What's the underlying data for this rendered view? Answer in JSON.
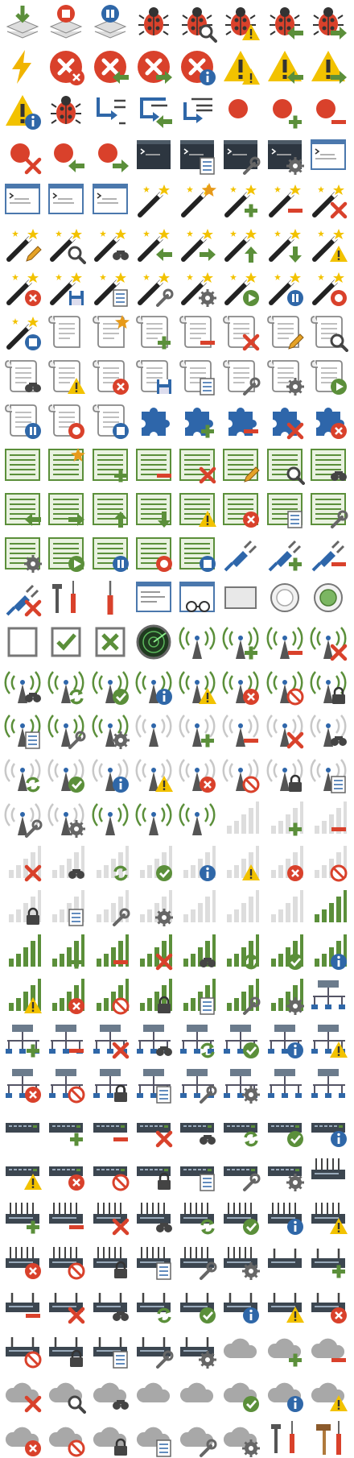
{
  "sheet": {
    "columns": 8,
    "rows": 32,
    "icons": [
      "download-stack-icon",
      "stop-stack-icon",
      "pause-stack-icon",
      "bug-icon",
      "bug-search-icon",
      "bug-warning-icon",
      "bug-back-icon",
      "bug-forward-icon",
      "lightning-icon",
      "error-icon",
      "error-back-icon",
      "error-forward-icon",
      "error-info-icon",
      "warning-icon",
      "warning-back-icon",
      "warning-forward-icon",
      "warning-info-icon",
      "bug-inspect-icon",
      "step-into-icon",
      "step-back-icon",
      "step-over-icon",
      "breakpoint-icon",
      "breakpoint-add-icon",
      "breakpoint-remove-icon",
      "breakpoint-delete-icon",
      "breakpoint-back-icon",
      "breakpoint-forward-icon",
      "console-icon",
      "console-checklist-icon",
      "console-wrench-icon",
      "console-gear-icon",
      "console-window-icon",
      "console-checklist-window-icon",
      "console-wrench-window-icon",
      "console-gear-window-icon",
      "wand-icon",
      "wand-star-icon",
      "wand-add-icon",
      "wand-remove-icon",
      "wand-delete-icon",
      "wand-edit-icon",
      "wand-search-icon",
      "wand-find-icon",
      "wand-back-icon",
      "wand-forward-icon",
      "wand-up-icon",
      "wand-down-icon",
      "wand-warning-icon",
      "wand-error-icon",
      "wand-save-icon",
      "wand-checklist-icon",
      "wand-wrench-icon",
      "wand-gear-icon",
      "wand-play-icon",
      "wand-pause-icon",
      "wand-record-icon",
      "wand-stop-icon",
      "script-icon",
      "script-star-icon",
      "script-add-icon",
      "script-remove-icon",
      "script-delete-icon",
      "script-edit-icon",
      "script-search-icon",
      "script-find-icon",
      "script-warning-icon",
      "script-error-icon",
      "script-save-icon",
      "script-checklist-icon",
      "script-wrench-icon",
      "script-gear-icon",
      "script-play-icon",
      "script-pause-icon",
      "script-record-icon",
      "script-stop-icon",
      "plugin-icon",
      "plugin-add-icon",
      "plugin-remove-icon",
      "plugin-delete-icon",
      "plugin-error-icon",
      "list-icon",
      "list-star-icon",
      "list-add-icon",
      "list-remove-icon",
      "list-delete-icon",
      "list-edit-icon",
      "list-search-icon",
      "list-find-icon",
      "list-back-icon",
      "list-forward-icon",
      "list-up-icon",
      "list-down-icon",
      "list-warning-icon",
      "list-error-icon",
      "list-checklist-icon",
      "list-wrench-icon",
      "list-gear-icon",
      "list-play-icon",
      "list-pause-icon",
      "list-record-icon",
      "list-stop-icon",
      "plug-icon",
      "plug-add-icon",
      "plug-remove-icon",
      "plug-delete-icon",
      "tools-icon",
      "screwdriver-icon",
      "window-form-icon",
      "window-glasses-icon",
      "rectangle-icon",
      "circle-icon",
      "circle-selected-icon",
      "checkbox-empty-icon",
      "checkbox-checked-icon",
      "checkbox-crossed-icon",
      "radar-icon",
      "antenna-icon",
      "antenna-add-icon",
      "antenna-remove-icon",
      "antenna-delete-icon",
      "antenna-find-icon",
      "antenna-sync-icon",
      "antenna-ok-icon",
      "antenna-info-icon",
      "antenna-warning-icon",
      "antenna-error-icon",
      "antenna-blocked-icon",
      "antenna-locked-icon",
      "antenna-checklist-icon",
      "antenna-wrench-icon",
      "antenna-gear-icon",
      "antenna-off-icon",
      "antenna-off-add-icon",
      "antenna-off-remove-icon",
      "antenna-off-delete-icon",
      "antenna-off-find-icon",
      "antenna-off-sync-icon",
      "antenna-off-ok-icon",
      "antenna-off-info-icon",
      "antenna-off-warning-icon",
      "antenna-off-error-icon",
      "antenna-off-blocked-icon",
      "antenna-off-locked-icon",
      "antenna-off-checklist-icon",
      "antenna-off-wrench-icon",
      "antenna-off-gear-icon",
      "antenna-green-icon",
      "antenna-green-alt-icon",
      "antenna-green-full-icon",
      "signal-empty-icon",
      "signal-add-icon",
      "signal-remove-icon",
      "signal-delete-icon",
      "signal-find-icon",
      "signal-sync-icon",
      "signal-ok-icon",
      "signal-info-icon",
      "signal-warning-icon",
      "signal-error-icon",
      "signal-blocked-icon",
      "signal-locked-icon",
      "signal-checklist-icon",
      "signal-wrench-icon",
      "signal-gear-icon",
      "signal-low-icon",
      "signal-medium-icon",
      "signal-high-icon",
      "signal-full-icon",
      "signal-full-alt-icon",
      "signal-full-add-icon",
      "signal-full-remove-icon",
      "signal-full-delete-icon",
      "signal-full-find-icon",
      "signal-full-sync-icon",
      "signal-full-ok-icon",
      "signal-full-info-icon",
      "signal-full-warning-icon",
      "signal-full-error-icon",
      "signal-full-blocked-icon",
      "signal-full-locked-icon",
      "signal-full-checklist-icon",
      "signal-full-wrench-icon",
      "signal-full-gear-icon",
      "network-icon",
      "network-add-icon",
      "network-remove-icon",
      "network-delete-icon",
      "network-find-icon",
      "network-sync-icon",
      "network-ok-icon",
      "network-info-icon",
      "network-warning-icon",
      "network-error-icon",
      "network-blocked-icon",
      "network-locked-icon",
      "network-checklist-icon",
      "network-wrench-icon",
      "network-gear-icon",
      "network-ok-alt-icon",
      "network-error-alt-icon",
      "switch-icon",
      "switch-add-icon",
      "switch-remove-icon",
      "switch-delete-icon",
      "switch-find-icon",
      "switch-sync-icon",
      "switch-ok-icon",
      "switch-info-icon",
      "switch-warning-icon",
      "switch-error-icon",
      "switch-blocked-icon",
      "switch-locked-icon",
      "switch-checklist-icon",
      "switch-wrench-icon",
      "switch-gear-icon",
      "hub-icon",
      "hub-add-icon",
      "hub-remove-icon",
      "hub-delete-icon",
      "hub-find-icon",
      "hub-sync-icon",
      "hub-ok-icon",
      "hub-info-icon",
      "hub-warning-icon",
      "hub-error-icon",
      "hub-blocked-icon",
      "hub-locked-icon",
      "hub-checklist-icon",
      "hub-wrench-icon",
      "hub-gear-icon",
      "router-icon",
      "router-add-icon",
      "router-remove-icon",
      "router-delete-icon",
      "router-find-icon",
      "router-sync-icon",
      "router-ok-icon",
      "router-info-icon",
      "router-warning-icon",
      "router-error-icon",
      "router-blocked-icon",
      "router-locked-icon",
      "router-checklist-icon",
      "router-wrench-icon",
      "router-gear-icon",
      "cloud-icon",
      "cloud-add-icon",
      "cloud-remove-icon",
      "cloud-delete-icon",
      "cloud-search-icon",
      "cloud-find-icon",
      "cloud-download-icon",
      "cloud-upload-icon",
      "cloud-ok-icon",
      "cloud-info-icon",
      "cloud-warning-icon",
      "cloud-error-icon",
      "cloud-blocked-icon",
      "cloud-locked-icon",
      "cloud-checklist-icon",
      "cloud-wrench-icon",
      "cloud-gear-icon",
      "tools-screwdriver-icon",
      "hammer-tools-icon"
    ]
  }
}
